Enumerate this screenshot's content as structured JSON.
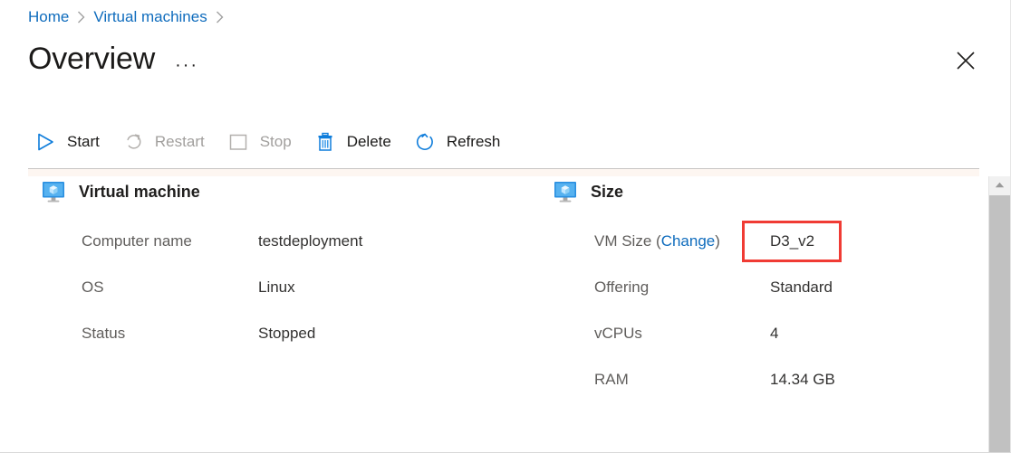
{
  "breadcrumb": {
    "items": [
      {
        "label": "Home"
      },
      {
        "label": "Virtual machines"
      }
    ],
    "separator_icon": "chevron-right-icon"
  },
  "header": {
    "title": "Overview",
    "more_label": "···",
    "close_icon": "close-icon"
  },
  "toolbar": {
    "commands": [
      {
        "label": "Start",
        "icon": "play-icon",
        "enabled": true
      },
      {
        "label": "Restart",
        "icon": "restart-icon",
        "enabled": false
      },
      {
        "label": "Stop",
        "icon": "stop-icon",
        "enabled": false
      },
      {
        "label": "Delete",
        "icon": "trash-icon",
        "enabled": true
      },
      {
        "label": "Refresh",
        "icon": "refresh-icon",
        "enabled": true
      }
    ]
  },
  "sections": {
    "virtual_machine": {
      "title": "Virtual machine",
      "icon": "vm-monitor-icon",
      "rows": [
        {
          "label": "Computer name",
          "value": "testdeployment"
        },
        {
          "label": "OS",
          "value": "Linux"
        },
        {
          "label": "Status",
          "value": "Stopped"
        }
      ]
    },
    "size": {
      "title": "Size",
      "icon": "vm-monitor-icon",
      "rows": [
        {
          "label": "VM Size (",
          "link": "Change",
          "label_suffix": ")",
          "value": "D3_v2",
          "highlighted": true
        },
        {
          "label": "Offering",
          "value": "Standard"
        },
        {
          "label": "vCPUs",
          "value": "4"
        },
        {
          "label": "RAM",
          "value": "14.34 GB"
        }
      ]
    }
  },
  "scrollbar": {
    "up_icon": "triangle-up-icon"
  },
  "colors": {
    "link": "#0f6cbd",
    "accent": "#0f6cbd",
    "highlight_box": "#f03b34",
    "label_text": "#605e5c",
    "value_text": "#323130",
    "disabled_text": "#a19f9d"
  }
}
